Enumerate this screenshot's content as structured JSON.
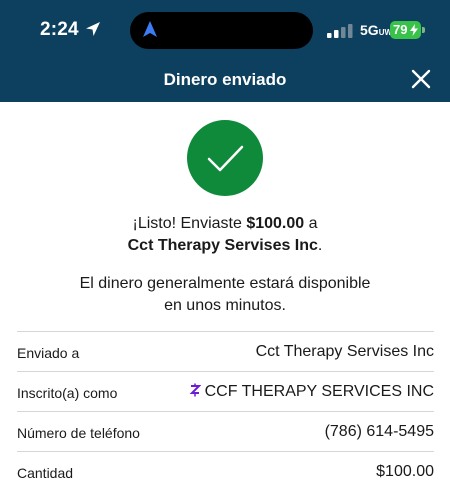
{
  "status_bar": {
    "time": "2:24",
    "network": "5G",
    "network_sub": "UW",
    "battery": "79",
    "signal_bars_active": 2,
    "signal_bars_total": 4,
    "icons": [
      "location-arrow-icon",
      "navigation-arrow-icon",
      "signal-icon",
      "battery-icon",
      "bolt-icon"
    ]
  },
  "header": {
    "title": "Dinero enviado",
    "close_icon": "close-icon",
    "background": "#0d3f5e"
  },
  "confirmation": {
    "icon": "checkmark-icon",
    "icon_color": "#0f8a3a",
    "prefix": "¡Listo! Enviaste ",
    "amount": "$100.00",
    "middle": " a",
    "recipient": "Cct Therapy Servises Inc",
    "suffix": ".",
    "availability_line1": "El dinero generalmente estará disponible",
    "availability_line2": "en unos minutos."
  },
  "details": {
    "rows": [
      {
        "label": "Enviado a",
        "value": "Cct Therapy Servises Inc"
      },
      {
        "label": "Inscrito(a) como",
        "value": "CCF THERAPY SERVICES INC",
        "icon": "zelle-icon",
        "icon_color": "#6d1ed4"
      },
      {
        "label": "Número de teléfono",
        "value": "(786) 614-5495"
      },
      {
        "label": "Cantidad",
        "value": "$100.00"
      }
    ]
  }
}
